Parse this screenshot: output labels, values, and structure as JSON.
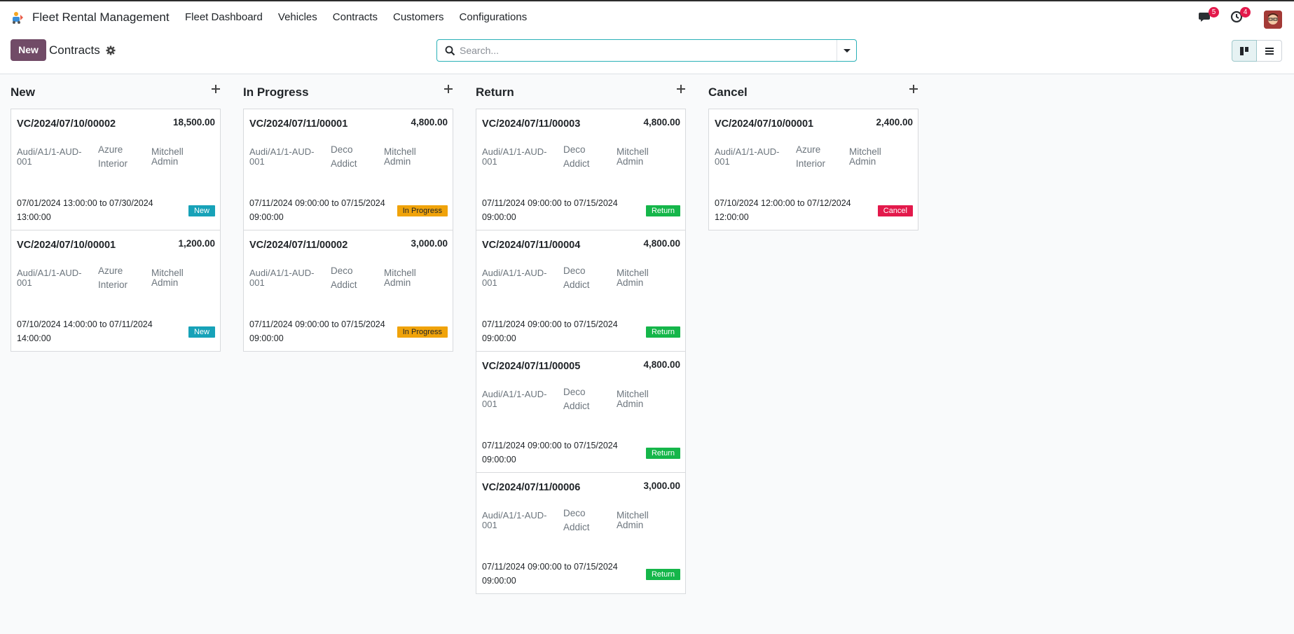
{
  "app": {
    "name": "Fleet Rental Management",
    "menu": [
      "Fleet Dashboard",
      "Vehicles",
      "Contracts",
      "Customers",
      "Configurations"
    ],
    "messages_count": "5",
    "activities_count": "4"
  },
  "control": {
    "new_label": "New",
    "title": "Contracts",
    "search_placeholder": "Search..."
  },
  "columns": [
    {
      "title": "New",
      "cards": [
        {
          "ref": "VC/2024/07/10/00002",
          "amount": "18,500.00",
          "vehicle": "Audi/A1/1-AUD-001",
          "customer": "Azure Interior",
          "user": "Mitchell Admin",
          "dates": "07/01/2024 13:00:00 to 07/30/2024 13:00:00",
          "status": "New"
        },
        {
          "ref": "VC/2024/07/10/00001",
          "amount": "1,200.00",
          "vehicle": "Audi/A1/1-AUD-001",
          "customer": "Azure Interior",
          "user": "Mitchell Admin",
          "dates": "07/10/2024 14:00:00 to 07/11/2024 14:00:00",
          "status": "New"
        }
      ]
    },
    {
      "title": "In Progress",
      "cards": [
        {
          "ref": "VC/2024/07/11/00001",
          "amount": "4,800.00",
          "vehicle": "Audi/A1/1-AUD-001",
          "customer": "Deco Addict",
          "user": "Mitchell Admin",
          "dates": "07/11/2024 09:00:00 to 07/15/2024 09:00:00",
          "status": "In Progress"
        },
        {
          "ref": "VC/2024/07/11/00002",
          "amount": "3,000.00",
          "vehicle": "Audi/A1/1-AUD-001",
          "customer": "Deco Addict",
          "user": "Mitchell Admin",
          "dates": "07/11/2024 09:00:00 to 07/15/2024 09:00:00",
          "status": "In Progress"
        }
      ]
    },
    {
      "title": "Return",
      "cards": [
        {
          "ref": "VC/2024/07/11/00003",
          "amount": "4,800.00",
          "vehicle": "Audi/A1/1-AUD-001",
          "customer": "Deco Addict",
          "user": "Mitchell Admin",
          "dates": "07/11/2024 09:00:00 to 07/15/2024 09:00:00",
          "status": "Return"
        },
        {
          "ref": "VC/2024/07/11/00004",
          "amount": "4,800.00",
          "vehicle": "Audi/A1/1-AUD-001",
          "customer": "Deco Addict",
          "user": "Mitchell Admin",
          "dates": "07/11/2024 09:00:00 to 07/15/2024 09:00:00",
          "status": "Return"
        },
        {
          "ref": "VC/2024/07/11/00005",
          "amount": "4,800.00",
          "vehicle": "Audi/A1/1-AUD-001",
          "customer": "Deco Addict",
          "user": "Mitchell Admin",
          "dates": "07/11/2024 09:00:00 to 07/15/2024 09:00:00",
          "status": "Return"
        },
        {
          "ref": "VC/2024/07/11/00006",
          "amount": "3,000.00",
          "vehicle": "Audi/A1/1-AUD-001",
          "customer": "Deco Addict",
          "user": "Mitchell Admin",
          "dates": "07/11/2024 09:00:00 to 07/15/2024 09:00:00",
          "status": "Return"
        }
      ]
    },
    {
      "title": "Cancel",
      "cards": [
        {
          "ref": "VC/2024/07/10/00001",
          "amount": "2,400.00",
          "vehicle": "Audi/A1/1-AUD-001",
          "customer": "Azure Interior",
          "user": "Mitchell Admin",
          "dates": "07/10/2024 12:00:00 to 07/12/2024 12:00:00",
          "status": "Cancel"
        }
      ]
    }
  ],
  "colors": {
    "brand": "#714b67",
    "status_new": "#17a2b8",
    "status_in_progress": "#f0a30a",
    "status_return": "#15b64a",
    "status_cancel": "#e3194b"
  }
}
